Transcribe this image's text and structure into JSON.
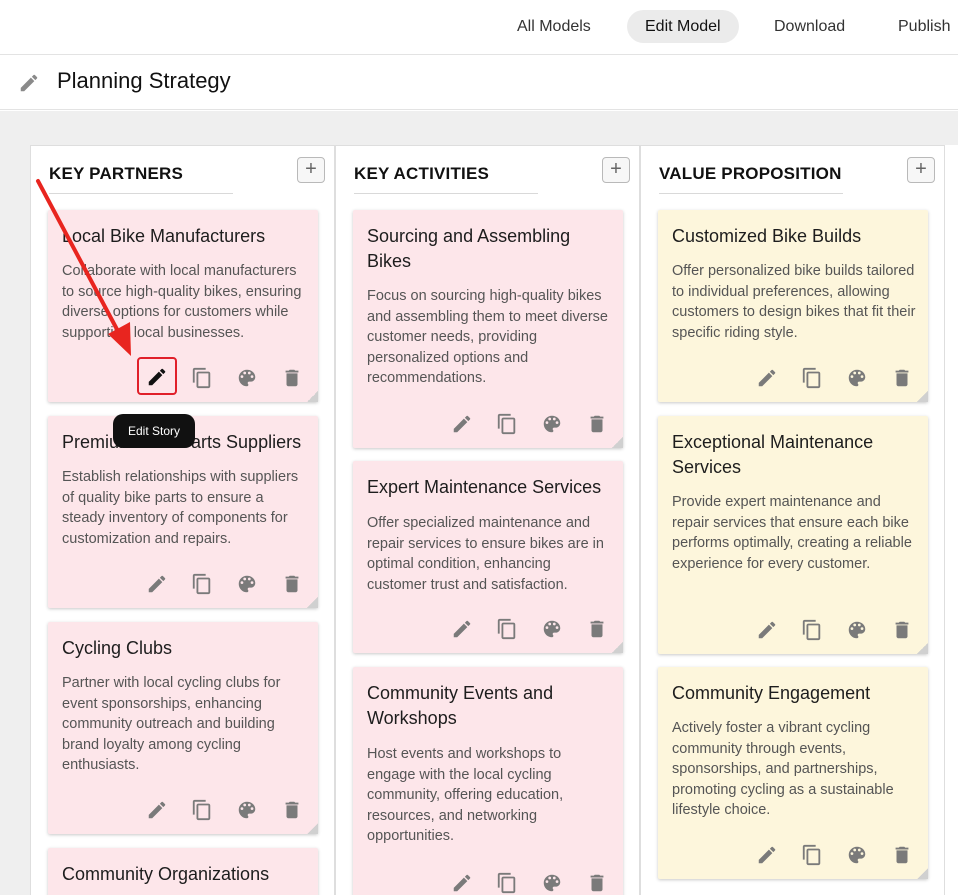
{
  "nav": {
    "all_models": "All Models",
    "edit_model": "Edit Model",
    "download": "Download",
    "publish": "Publish"
  },
  "page": {
    "title": "Planning Strategy",
    "title_icon": "pencil-icon"
  },
  "tooltip": {
    "text": "Edit Story"
  },
  "colors": {
    "pink_card": "#fde6ea",
    "yellow_card": "#fdf6dc",
    "highlight": "#e0202a",
    "arrow": "#e8251f"
  },
  "columns": [
    {
      "heading": "KEY PARTNERS",
      "add_label": "+",
      "cards": [
        {
          "title": "Local Bike Manufacturers",
          "body": "Collaborate with local manufacturers to source high-quality bikes, ensuring diverse options for customers while supporting local businesses."
        },
        {
          "title": "Premium Bike Parts Suppliers",
          "body": "Establish relationships with suppliers of quality bike parts to ensure a steady inventory of components for customization and repairs."
        },
        {
          "title": "Cycling Clubs",
          "body": "Partner with local cycling clubs for event sponsorships, enhancing community outreach and building brand loyalty among cycling enthusiasts."
        },
        {
          "title": "Community Organizations",
          "body": ""
        }
      ]
    },
    {
      "heading": "KEY ACTIVITIES",
      "add_label": "+",
      "cards": [
        {
          "title": "Sourcing and Assembling Bikes",
          "body": "Focus on sourcing high-quality bikes and assembling them to meet diverse customer needs, providing personalized options and recommendations."
        },
        {
          "title": "Expert Maintenance Services",
          "body": "Offer specialized maintenance and repair services to ensure bikes are in optimal condition, enhancing customer trust and satisfaction."
        },
        {
          "title": "Community Events and Workshops",
          "body": "Host events and workshops to engage with the local cycling community, offering education, resources, and networking opportunities."
        }
      ]
    },
    {
      "heading": "VALUE PROPOSITION",
      "add_label": "+",
      "cards": [
        {
          "title": "Customized Bike Builds",
          "body": "Offer personalized bike builds tailored to individual preferences, allowing customers to design bikes that fit their specific riding style."
        },
        {
          "title": "Exceptional Maintenance Services",
          "body": "Provide expert maintenance and repair services that ensure each bike performs optimally, creating a reliable experience for every customer."
        },
        {
          "title": "Community Engagement",
          "body": "Actively foster a vibrant cycling community through events, sponsorships, and partnerships, promoting cycling as a sustainable lifestyle choice."
        }
      ]
    }
  ],
  "card_actions": [
    "edit-icon",
    "copy-icon",
    "palette-icon",
    "delete-icon"
  ]
}
